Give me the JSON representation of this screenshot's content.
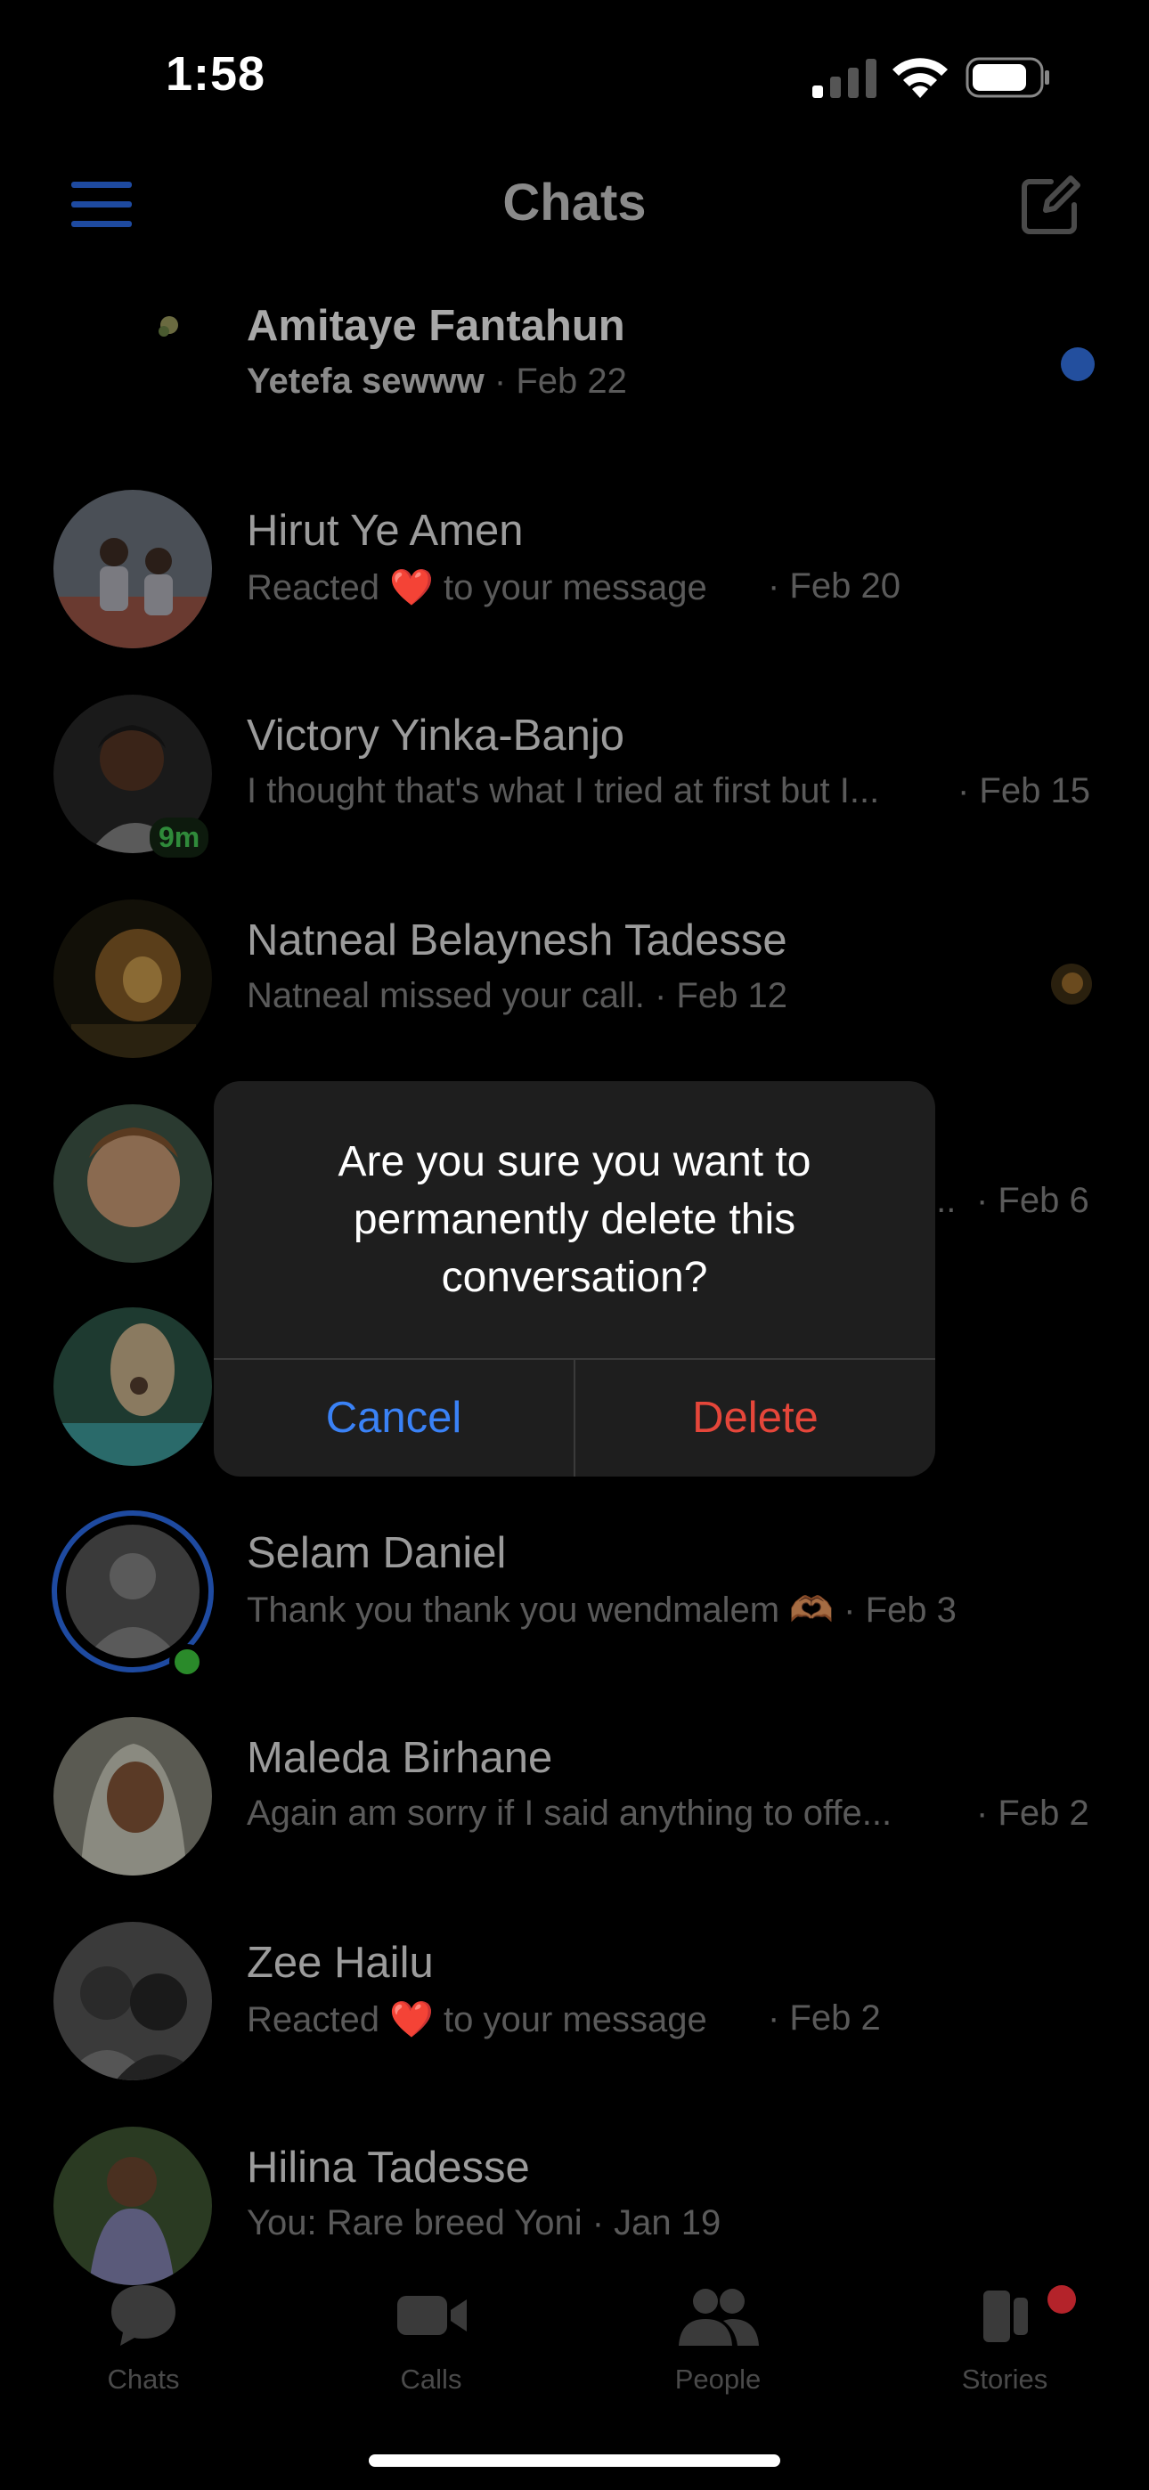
{
  "status_bar": {
    "time": "1:58"
  },
  "header": {
    "title": "Chats"
  },
  "chats": [
    {
      "name": "Amitaye Fantahun",
      "preview": "Yetefa sewww",
      "date": "· Feb 22",
      "unread": true
    },
    {
      "name": "Hirut Ye Amen",
      "preview": "Reacted ❤️ to your message",
      "date": "· Feb 20"
    },
    {
      "name": "Victory Yinka-Banjo",
      "preview": "I thought that's what I tried at first but I...",
      "date": "· Feb 15",
      "badge": "9m"
    },
    {
      "name": "Natneal Belaynesh Tadesse",
      "preview": "Natneal missed your call.",
      "date": "· Feb 12"
    },
    {
      "name": "",
      "preview": "...",
      "date": "· Feb 6"
    },
    {
      "name": "",
      "preview": "",
      "date": ""
    },
    {
      "name": "Selam Daniel",
      "preview": "Thank you thank you wendmalem 🫶🏾",
      "date": "· Feb 3"
    },
    {
      "name": "Maleda Birhane",
      "preview": "Again am sorry if I said anything to offe...",
      "date": "· Feb 2"
    },
    {
      "name": "Zee Hailu",
      "preview": "Reacted ❤️ to your message",
      "date": "· Feb 2"
    },
    {
      "name": "Hilina Tadesse",
      "preview": "You: Rare breed Yoni",
      "date": "· Jan 19"
    }
  ],
  "dialog": {
    "message": "Are you sure you want to permanently delete this conversation?",
    "cancel_label": "Cancel",
    "delete_label": "Delete"
  },
  "tabs": [
    {
      "label": "Chats",
      "icon": "chat-bubble-icon"
    },
    {
      "label": "Calls",
      "icon": "video-camera-icon"
    },
    {
      "label": "People",
      "icon": "people-icon"
    },
    {
      "label": "Stories",
      "icon": "stories-icon"
    }
  ],
  "colors": {
    "accent_blue": "#3a82f6",
    "delete_red": "#e5463a",
    "unread_dot": "#234f9e",
    "online_green": "#2a8a2a"
  }
}
